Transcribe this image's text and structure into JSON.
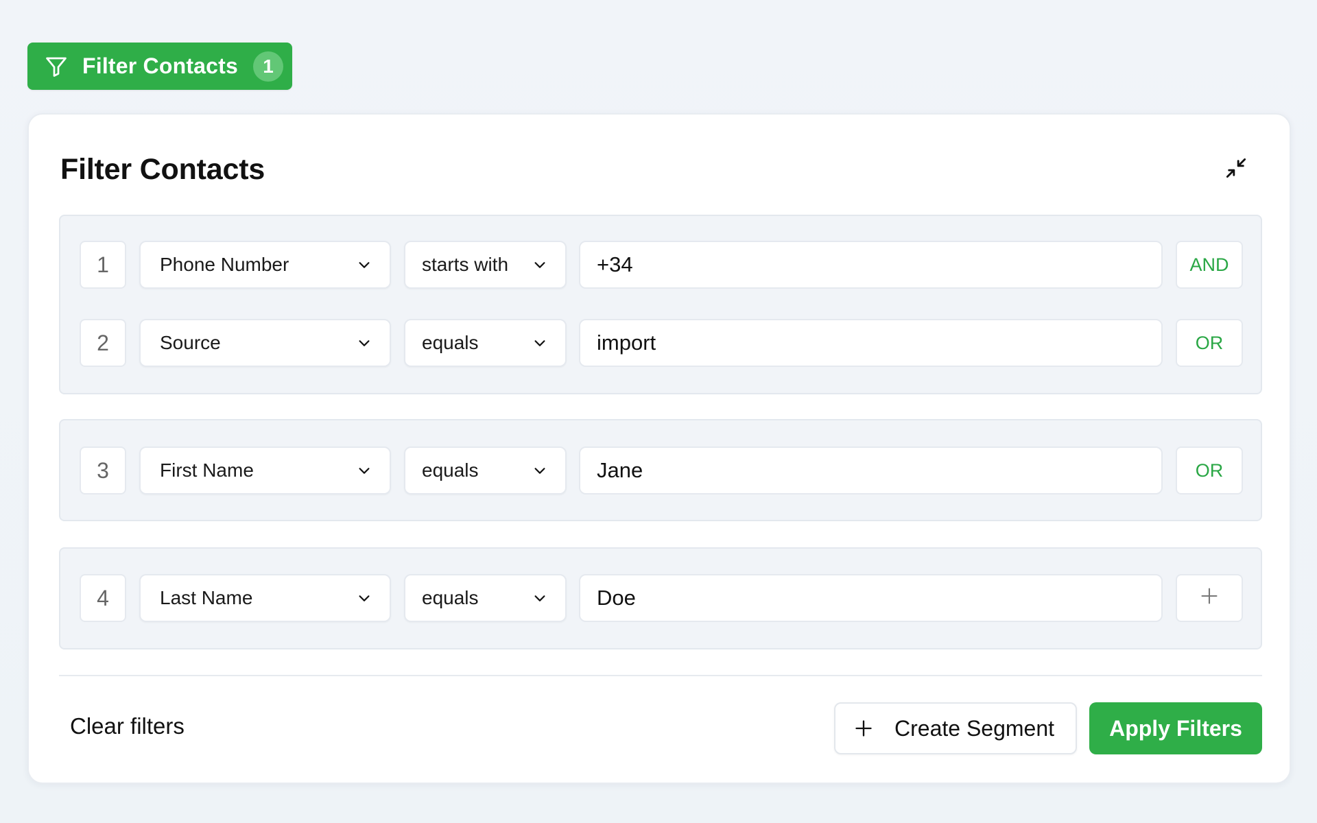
{
  "toggle": {
    "label": "Filter Contacts",
    "count": "1",
    "icon": "filter-icon"
  },
  "panel": {
    "title": "Filter Contacts",
    "collapse_icon": "collapse-icon"
  },
  "groups": [
    {
      "rows": [
        {
          "index": "1",
          "field": "Phone Number",
          "operator": "starts with",
          "value": "+34",
          "logic": "AND"
        },
        {
          "index": "2",
          "field": "Source",
          "operator": "equals",
          "value": "import",
          "logic": "OR"
        }
      ]
    },
    {
      "rows": [
        {
          "index": "3",
          "field": "First Name",
          "operator": "equals",
          "value": "Jane",
          "logic": "OR"
        }
      ]
    },
    {
      "rows": [
        {
          "index": "4",
          "field": "Last Name",
          "operator": "equals",
          "value": "Doe",
          "logic_icon": "plus-icon"
        }
      ]
    }
  ],
  "footer": {
    "clear_label": "Clear filters",
    "create_segment_label": "Create Segment",
    "apply_label": "Apply Filters"
  },
  "colors": {
    "accent": "#2fae48",
    "logic_text": "#2aa745",
    "group_bg": "#f1f4f8"
  }
}
